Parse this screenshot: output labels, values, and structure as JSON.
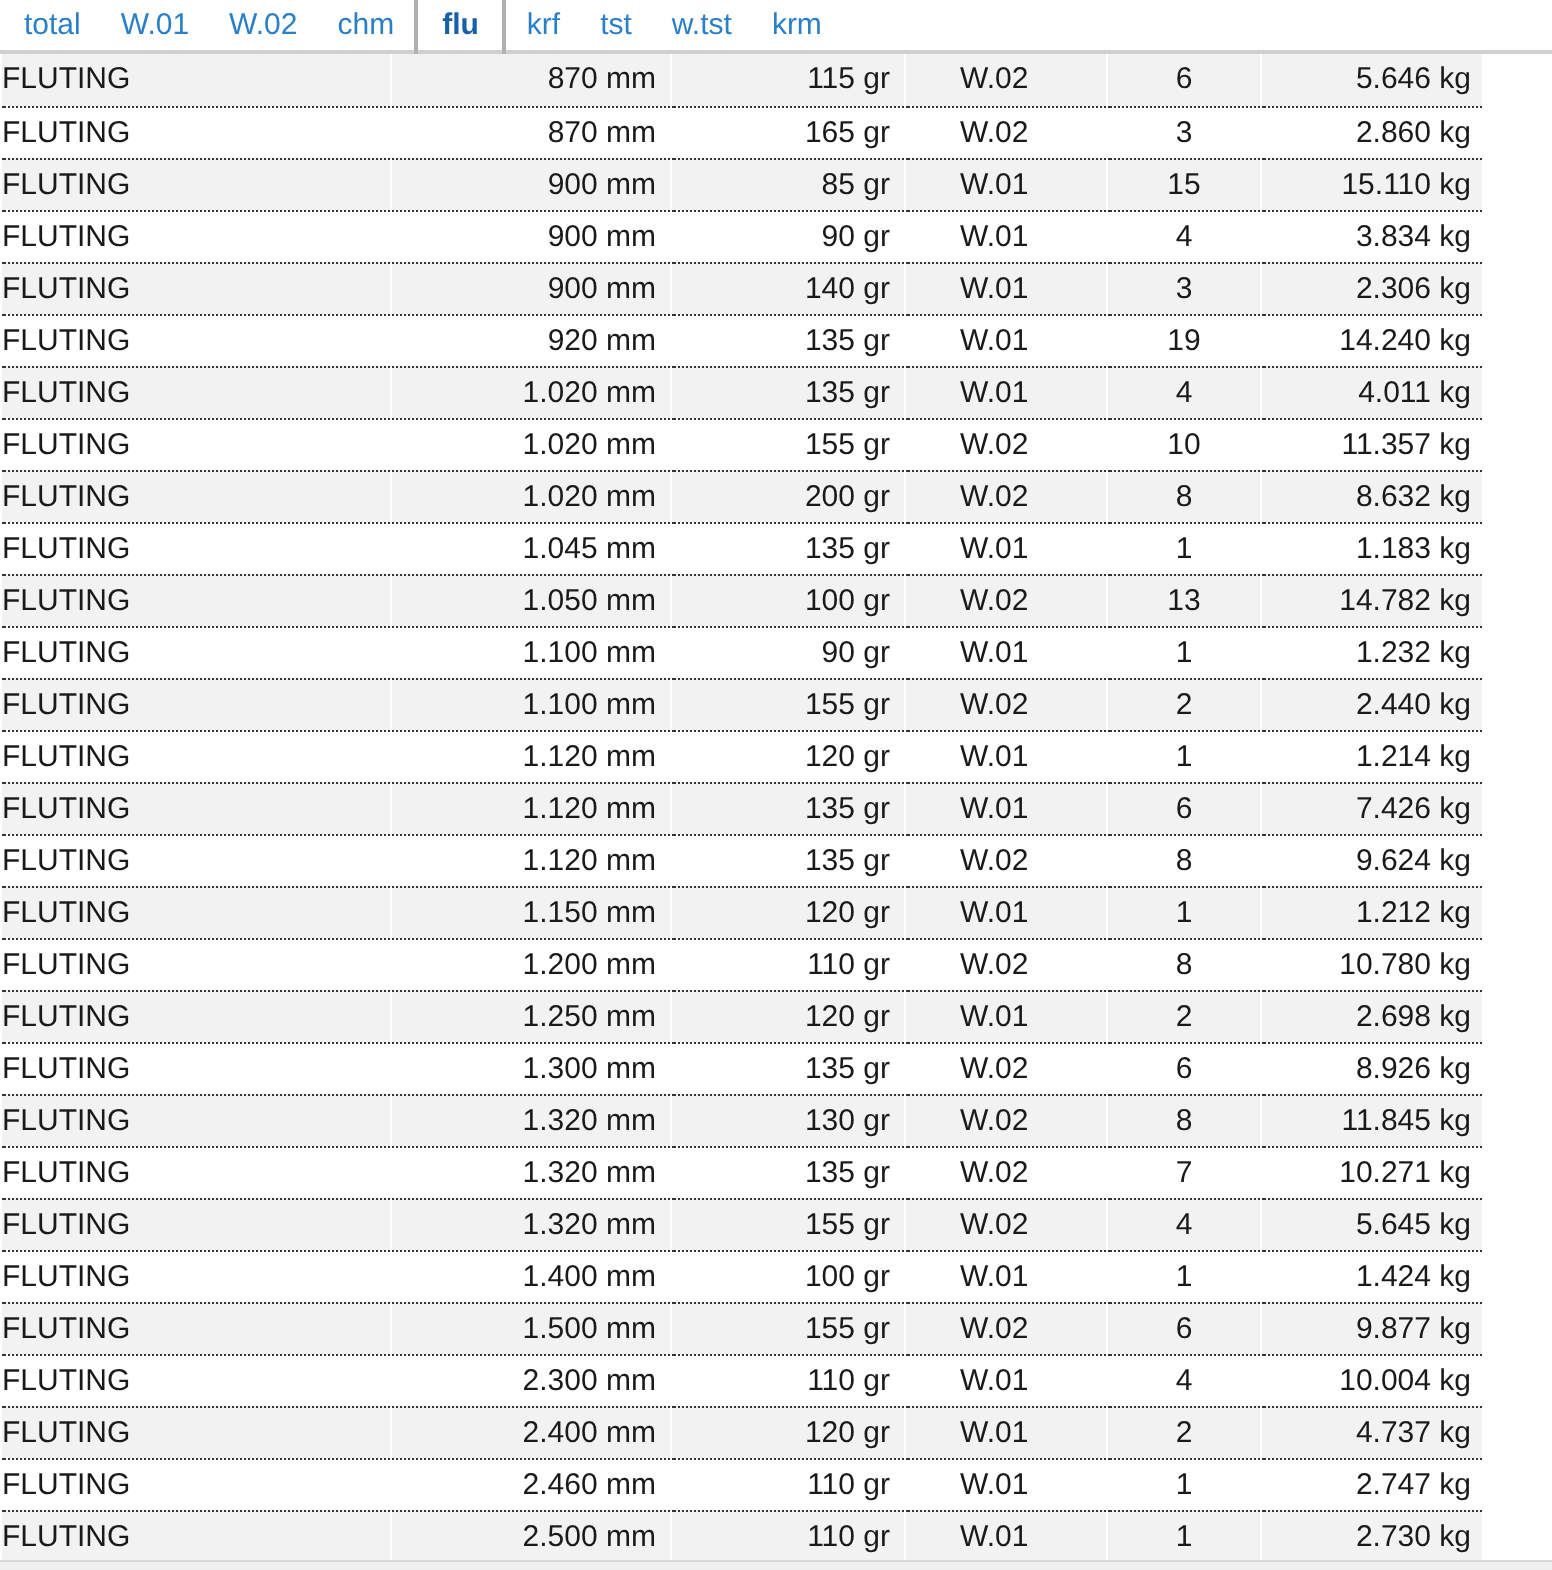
{
  "tabs": [
    {
      "label": "total",
      "selected": false
    },
    {
      "label": "W.01",
      "selected": false
    },
    {
      "label": "W.02",
      "selected": false
    },
    {
      "label": "chm",
      "selected": false
    },
    {
      "label": "flu",
      "selected": true
    },
    {
      "label": "krf",
      "selected": false
    },
    {
      "label": "tst",
      "selected": false
    },
    {
      "label": "w.tst",
      "selected": false
    },
    {
      "label": "krm",
      "selected": false
    }
  ],
  "table": {
    "rows": [
      [
        "FLUTING",
        "870 mm",
        "115 gr",
        "W.02",
        "6",
        "5.646 kg"
      ],
      [
        "FLUTING",
        "870 mm",
        "165 gr",
        "W.02",
        "3",
        "2.860 kg"
      ],
      [
        "FLUTING",
        "900 mm",
        "85 gr",
        "W.01",
        "15",
        "15.110 kg"
      ],
      [
        "FLUTING",
        "900 mm",
        "90 gr",
        "W.01",
        "4",
        "3.834 kg"
      ],
      [
        "FLUTING",
        "900 mm",
        "140 gr",
        "W.01",
        "3",
        "2.306 kg"
      ],
      [
        "FLUTING",
        "920 mm",
        "135 gr",
        "W.01",
        "19",
        "14.240 kg"
      ],
      [
        "FLUTING",
        "1.020 mm",
        "135 gr",
        "W.01",
        "4",
        "4.011 kg"
      ],
      [
        "FLUTING",
        "1.020 mm",
        "155 gr",
        "W.02",
        "10",
        "11.357 kg"
      ],
      [
        "FLUTING",
        "1.020 mm",
        "200 gr",
        "W.02",
        "8",
        "8.632 kg"
      ],
      [
        "FLUTING",
        "1.045 mm",
        "135 gr",
        "W.01",
        "1",
        "1.183 kg"
      ],
      [
        "FLUTING",
        "1.050 mm",
        "100 gr",
        "W.02",
        "13",
        "14.782 kg"
      ],
      [
        "FLUTING",
        "1.100 mm",
        "90 gr",
        "W.01",
        "1",
        "1.232 kg"
      ],
      [
        "FLUTING",
        "1.100 mm",
        "155 gr",
        "W.02",
        "2",
        "2.440 kg"
      ],
      [
        "FLUTING",
        "1.120 mm",
        "120 gr",
        "W.01",
        "1",
        "1.214 kg"
      ],
      [
        "FLUTING",
        "1.120 mm",
        "135 gr",
        "W.01",
        "6",
        "7.426 kg"
      ],
      [
        "FLUTING",
        "1.120 mm",
        "135 gr",
        "W.02",
        "8",
        "9.624 kg"
      ],
      [
        "FLUTING",
        "1.150 mm",
        "120 gr",
        "W.01",
        "1",
        "1.212 kg"
      ],
      [
        "FLUTING",
        "1.200 mm",
        "110 gr",
        "W.02",
        "8",
        "10.780 kg"
      ],
      [
        "FLUTING",
        "1.250 mm",
        "120 gr",
        "W.01",
        "2",
        "2.698 kg"
      ],
      [
        "FLUTING",
        "1.300 mm",
        "135 gr",
        "W.02",
        "6",
        "8.926 kg"
      ],
      [
        "FLUTING",
        "1.320 mm",
        "130 gr",
        "W.02",
        "8",
        "11.845 kg"
      ],
      [
        "FLUTING",
        "1.320 mm",
        "135 gr",
        "W.02",
        "7",
        "10.271 kg"
      ],
      [
        "FLUTING",
        "1.320 mm",
        "155 gr",
        "W.02",
        "4",
        "5.645 kg"
      ],
      [
        "FLUTING",
        "1.400 mm",
        "100 gr",
        "W.01",
        "1",
        "1.424 kg"
      ],
      [
        "FLUTING",
        "1.500 mm",
        "155 gr",
        "W.02",
        "6",
        "9.877 kg"
      ],
      [
        "FLUTING",
        "2.300 mm",
        "110 gr",
        "W.01",
        "4",
        "10.004 kg"
      ],
      [
        "FLUTING",
        "2.400 mm",
        "120 gr",
        "W.01",
        "2",
        "4.737 kg"
      ],
      [
        "FLUTING",
        "2.460 mm",
        "110 gr",
        "W.01",
        "1",
        "2.747 kg"
      ],
      [
        "FLUTING",
        "2.500 mm",
        "110 gr",
        "W.01",
        "1",
        "2.730 kg"
      ]
    ]
  }
}
